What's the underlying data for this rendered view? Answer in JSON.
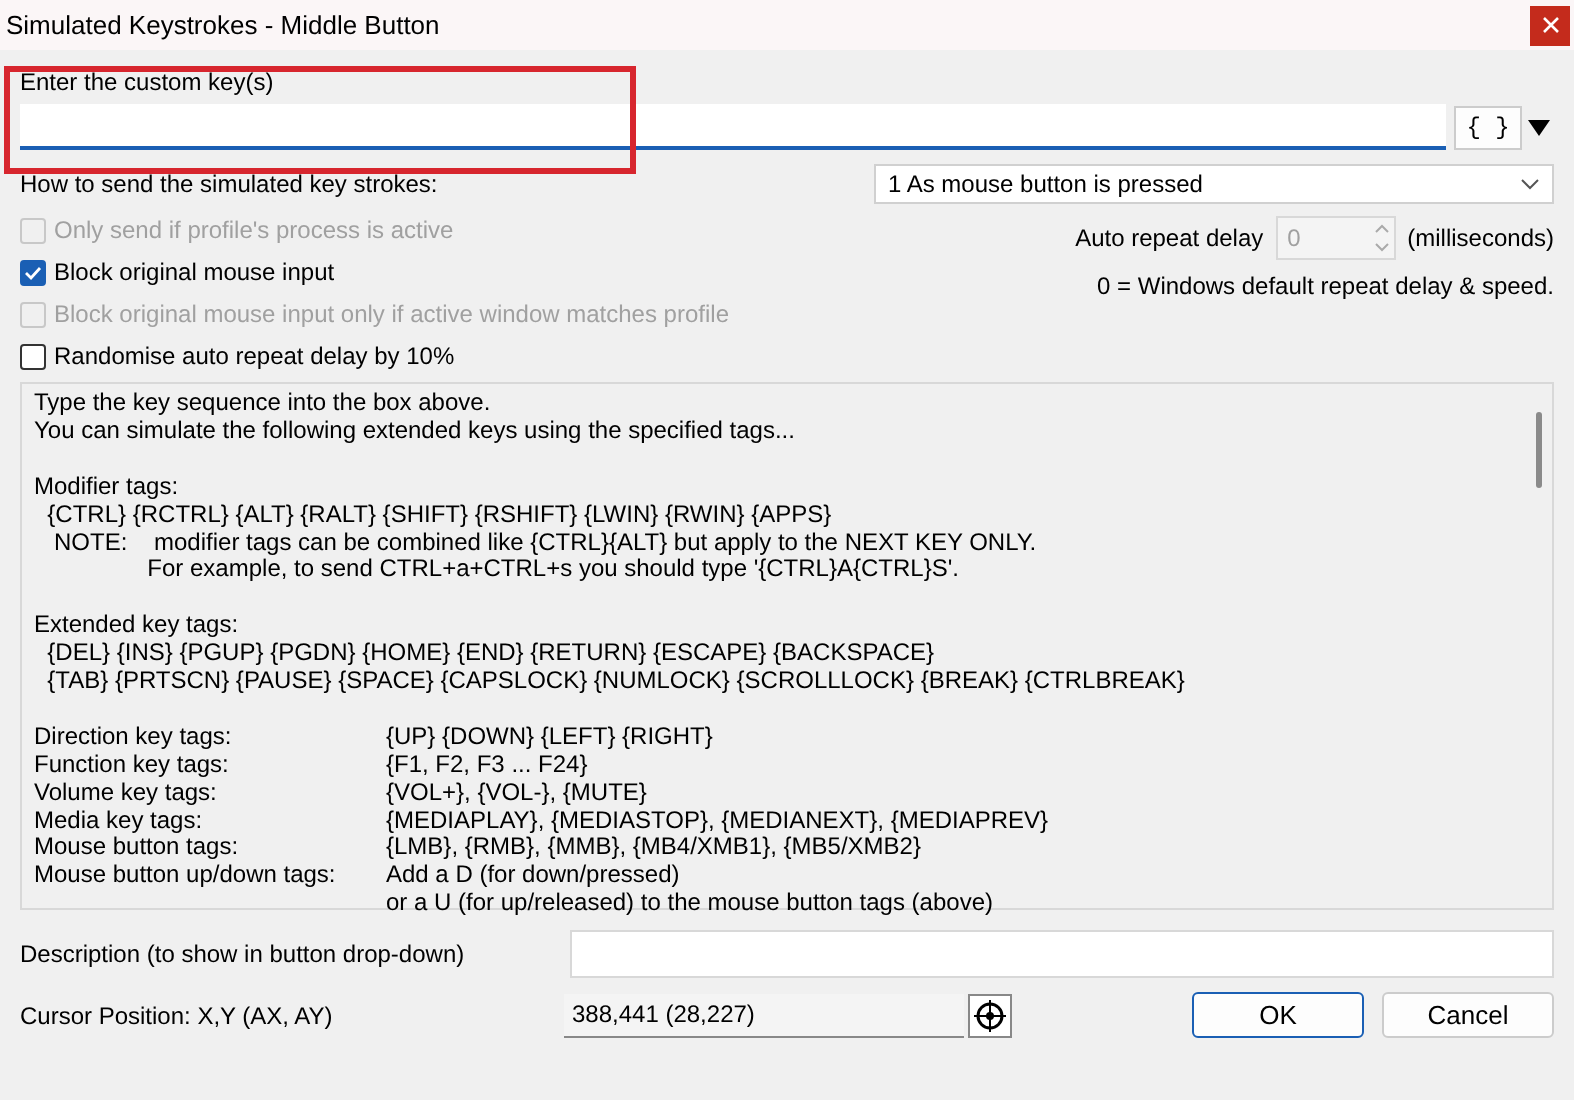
{
  "window": {
    "title": "Simulated Keystrokes - Middle Button"
  },
  "custom_keys": {
    "label": "Enter the custom key(s)",
    "tags_button": "{ }",
    "highlighted": true
  },
  "send_mode": {
    "label": "How to send the simulated key strokes:",
    "value": "1 As mouse button is pressed"
  },
  "options": [
    {
      "label": "Only send if profile's process is active",
      "checked": false,
      "disabled": true
    },
    {
      "label": "Block original mouse input",
      "checked": true,
      "disabled": false
    },
    {
      "label": "Block original mouse input only if active window matches profile",
      "checked": false,
      "disabled": true
    },
    {
      "label": "Randomise auto repeat delay by 10%",
      "checked": false,
      "disabled": false
    }
  ],
  "auto_repeat": {
    "label": "Auto repeat delay",
    "value": "0",
    "unit": "(milliseconds)",
    "note": "0 = Windows default repeat delay & speed."
  },
  "help": [
    {
      "kind": "text",
      "text": "Type the key sequence into the box above."
    },
    {
      "kind": "text",
      "text": "You can simulate the following extended keys using the specified tags..."
    },
    {
      "kind": "blank"
    },
    {
      "kind": "text",
      "text": "Modifier tags:"
    },
    {
      "kind": "text",
      "text": "  {CTRL} {RCTRL} {ALT} {RALT} {SHIFT} {RSHIFT} {LWIN} {RWIN} {APPS}"
    },
    {
      "kind": "text",
      "text": "   NOTE:    modifier tags can be combined like {CTRL}{ALT} but apply to the NEXT KEY ONLY."
    },
    {
      "kind": "text",
      "text": "                 For example, to send CTRL+a+CTRL+s you should type '{CTRL}A{CTRL}S'."
    },
    {
      "kind": "blank"
    },
    {
      "kind": "text",
      "text": "Extended key tags:"
    },
    {
      "kind": "text",
      "text": "  {DEL} {INS} {PGUP} {PGDN} {HOME} {END} {RETURN} {ESCAPE} {BACKSPACE}"
    },
    {
      "kind": "text",
      "text": "  {TAB} {PRTSCN} {PAUSE} {SPACE} {CAPSLOCK} {NUMLOCK} {SCROLLLOCK} {BREAK} {CTRLBREAK}"
    },
    {
      "kind": "blank"
    },
    {
      "kind": "pair",
      "label": "Direction key tags:",
      "text": "{UP} {DOWN} {LEFT} {RIGHT}"
    },
    {
      "kind": "pair",
      "label": "Function key tags:",
      "text": "{F1, F2, F3 ... F24}"
    },
    {
      "kind": "pair",
      "label": "Volume key tags:",
      "text": "{VOL+}, {VOL-}, {MUTE}"
    },
    {
      "kind": "pair",
      "label": "Media key tags:",
      "text": "{MEDIAPLAY}, {MEDIASTOP}, {MEDIANEXT}, {MEDIAPREV}"
    },
    {
      "kind": "pair",
      "label": "Mouse button tags:",
      "text": "{LMB}, {RMB}, {MMB}, {MB4/XMB1}, {MB5/XMB2}"
    },
    {
      "kind": "pair",
      "label": "Mouse button up/down tags:",
      "text": "Add a D (for down/pressed)"
    },
    {
      "kind": "pair",
      "text": "or a U (for up/released) to the mouse button tags (above)"
    }
  ],
  "description": {
    "label": "Description (to show in button drop-down)"
  },
  "cursor_position": {
    "label": "Cursor Position: X,Y (AX, AY)",
    "value": "388,441 (28,227)"
  },
  "buttons": [
    {
      "label": "OK",
      "default": true
    },
    {
      "label": "Cancel",
      "default": false
    }
  ]
}
